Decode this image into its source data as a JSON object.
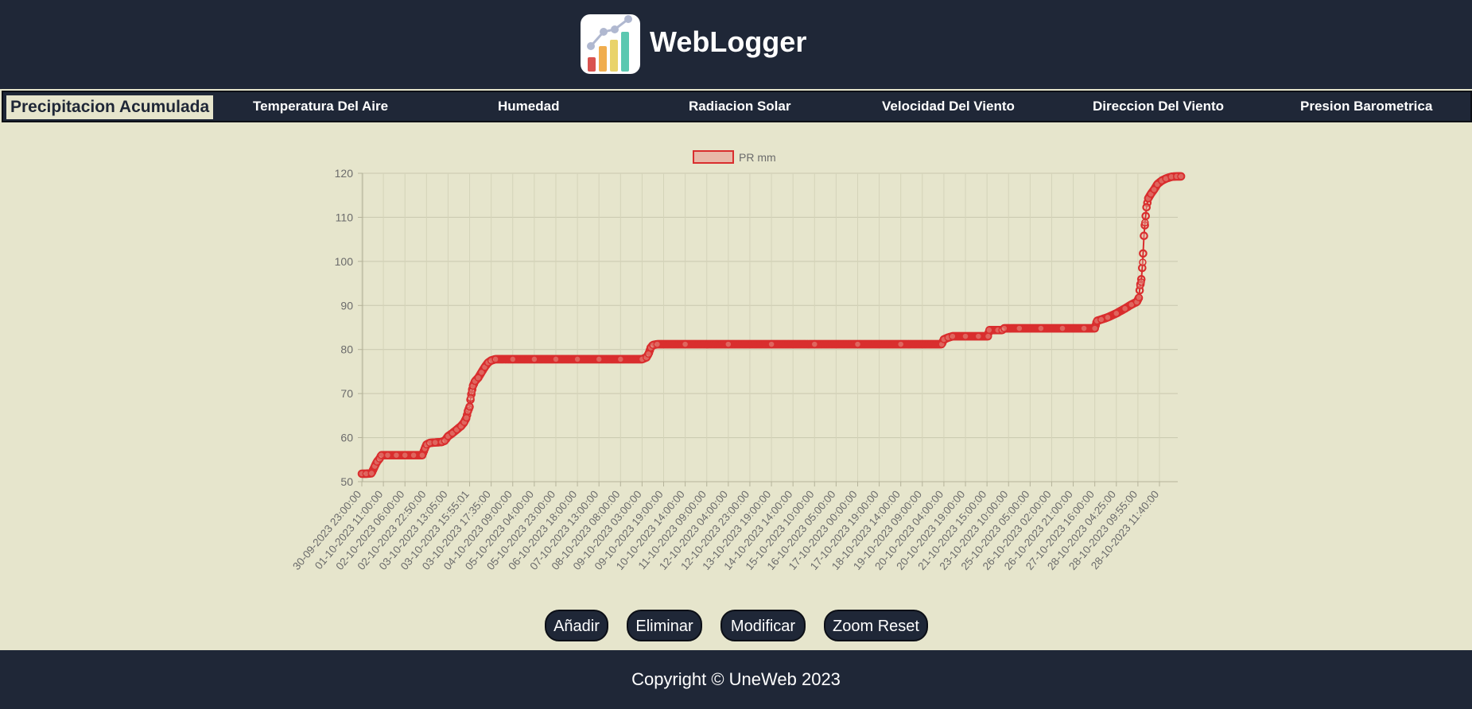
{
  "header": {
    "title": "WebLogger",
    "logo_icon": "bar-chart-logo-icon"
  },
  "nav": {
    "active_index": 0,
    "items": [
      {
        "label": "Precipitacion Acumulada"
      },
      {
        "label": "Temperatura Del Aire"
      },
      {
        "label": "Humedad"
      },
      {
        "label": "Radiacion Solar"
      },
      {
        "label": "Velocidad Del Viento"
      },
      {
        "label": "Direccion Del Viento"
      },
      {
        "label": "Presion Barometrica"
      }
    ]
  },
  "buttons": {
    "add": "Añadir",
    "delete": "Eliminar",
    "modify": "Modificar",
    "zoom_reset": "Zoom Reset"
  },
  "footer": {
    "copyright": "Copyright © UneWeb 2023"
  },
  "colors": {
    "header_bg": "#1f2737",
    "page_bg": "#e6e5cc",
    "series_line": "#d92e2e",
    "series_fill": "#e8b8a8"
  },
  "chart_data": {
    "type": "line",
    "title": "",
    "xlabel": "",
    "ylabel": "",
    "ylim": [
      50,
      120
    ],
    "yticks": [
      50,
      60,
      70,
      80,
      90,
      100,
      110,
      120
    ],
    "grid": true,
    "legend_position": "top",
    "categories": [
      "30-09-2023 23:00:00",
      "01-10-2023 11:00:00",
      "02-10-2023 06:00:00",
      "02-10-2023 22:50:00",
      "03-10-2023 13:05:00",
      "03-10-2023 15:55:01",
      "03-10-2023 17:35:00",
      "04-10-2023 09:00:00",
      "05-10-2023 04:00:00",
      "05-10-2023 23:00:00",
      "06-10-2023 18:00:00",
      "07-10-2023 13:00:00",
      "08-10-2023 08:00:00",
      "09-10-2023 03:00:00",
      "09-10-2023 19:00:00",
      "10-10-2023 14:00:00",
      "11-10-2023 09:00:00",
      "12-10-2023 04:00:00",
      "12-10-2023 23:00:00",
      "13-10-2023 19:00:00",
      "14-10-2023 14:00:00",
      "15-10-2023 10:00:00",
      "16-10-2023 05:00:00",
      "17-10-2023 00:00:00",
      "17-10-2023 19:00:00",
      "18-10-2023 14:00:00",
      "19-10-2023 09:00:00",
      "20-10-2023 04:00:00",
      "20-10-2023 19:00:00",
      "21-10-2023 15:00:00",
      "23-10-2023 10:00:00",
      "25-10-2023 05:00:00",
      "26-10-2023 02:00:00",
      "26-10-2023 21:00:00",
      "27-10-2023 16:00:00",
      "28-10-2023 04:25:00",
      "28-10-2023 09:55:00",
      "28-10-2023 11:40:00"
    ],
    "series": [
      {
        "name": "PR mm",
        "color": "#d92e2e",
        "fill": "#e8b8a8",
        "points": [
          {
            "x": 0.0,
            "y": 51.8
          },
          {
            "x": 0.2,
            "y": 51.8
          },
          {
            "x": 0.45,
            "y": 51.9
          },
          {
            "x": 0.6,
            "y": 53.5
          },
          {
            "x": 0.7,
            "y": 54.5
          },
          {
            "x": 0.82,
            "y": 55.2
          },
          {
            "x": 0.9,
            "y": 56.0
          },
          {
            "x": 1.2,
            "y": 56.0
          },
          {
            "x": 1.6,
            "y": 56.0
          },
          {
            "x": 2.0,
            "y": 56.0
          },
          {
            "x": 2.4,
            "y": 56.0
          },
          {
            "x": 2.8,
            "y": 56.0
          },
          {
            "x": 2.92,
            "y": 57.5
          },
          {
            "x": 3.0,
            "y": 58.4
          },
          {
            "x": 3.15,
            "y": 58.8
          },
          {
            "x": 3.4,
            "y": 58.9
          },
          {
            "x": 3.7,
            "y": 59.0
          },
          {
            "x": 3.85,
            "y": 59.3
          },
          {
            "x": 4.0,
            "y": 60.3
          },
          {
            "x": 4.2,
            "y": 61.0
          },
          {
            "x": 4.4,
            "y": 61.8
          },
          {
            "x": 4.6,
            "y": 62.6
          },
          {
            "x": 4.75,
            "y": 63.5
          },
          {
            "x": 4.85,
            "y": 64.5
          },
          {
            "x": 4.92,
            "y": 66.0
          },
          {
            "x": 5.0,
            "y": 67.0
          },
          {
            "x": 5.05,
            "y": 69.0
          },
          {
            "x": 5.1,
            "y": 70.4
          },
          {
            "x": 5.15,
            "y": 71.7
          },
          {
            "x": 5.25,
            "y": 72.8
          },
          {
            "x": 5.4,
            "y": 73.6
          },
          {
            "x": 5.55,
            "y": 74.8
          },
          {
            "x": 5.7,
            "y": 76.0
          },
          {
            "x": 5.85,
            "y": 77.0
          },
          {
            "x": 6.0,
            "y": 77.5
          },
          {
            "x": 6.2,
            "y": 77.8
          },
          {
            "x": 7.0,
            "y": 77.8
          },
          {
            "x": 8.0,
            "y": 77.8
          },
          {
            "x": 9.0,
            "y": 77.8
          },
          {
            "x": 10.0,
            "y": 77.8
          },
          {
            "x": 11.0,
            "y": 77.8
          },
          {
            "x": 12.0,
            "y": 77.8
          },
          {
            "x": 13.0,
            "y": 77.8
          },
          {
            "x": 13.2,
            "y": 78.2
          },
          {
            "x": 13.3,
            "y": 79.0
          },
          {
            "x": 13.4,
            "y": 80.4
          },
          {
            "x": 13.5,
            "y": 81.0
          },
          {
            "x": 13.7,
            "y": 81.2
          },
          {
            "x": 15.0,
            "y": 81.2
          },
          {
            "x": 17.0,
            "y": 81.2
          },
          {
            "x": 19.0,
            "y": 81.2
          },
          {
            "x": 21.0,
            "y": 81.2
          },
          {
            "x": 23.0,
            "y": 81.2
          },
          {
            "x": 25.0,
            "y": 81.2
          },
          {
            "x": 26.9,
            "y": 81.2
          },
          {
            "x": 27.0,
            "y": 82.3
          },
          {
            "x": 27.2,
            "y": 82.7
          },
          {
            "x": 27.4,
            "y": 83.0
          },
          {
            "x": 28.0,
            "y": 83.0
          },
          {
            "x": 28.6,
            "y": 83.0
          },
          {
            "x": 29.05,
            "y": 83.0
          },
          {
            "x": 29.1,
            "y": 84.4
          },
          {
            "x": 29.5,
            "y": 84.4
          },
          {
            "x": 29.7,
            "y": 84.4
          },
          {
            "x": 29.8,
            "y": 84.8
          },
          {
            "x": 30.5,
            "y": 84.8
          },
          {
            "x": 31.5,
            "y": 84.8
          },
          {
            "x": 32.5,
            "y": 84.8
          },
          {
            "x": 33.5,
            "y": 84.8
          },
          {
            "x": 34.0,
            "y": 84.8
          },
          {
            "x": 34.1,
            "y": 86.5
          },
          {
            "x": 34.3,
            "y": 86.8
          },
          {
            "x": 34.6,
            "y": 87.3
          },
          {
            "x": 35.0,
            "y": 88.2
          },
          {
            "x": 35.4,
            "y": 89.3
          },
          {
            "x": 35.7,
            "y": 90.2
          },
          {
            "x": 35.95,
            "y": 90.8
          },
          {
            "x": 36.05,
            "y": 91.8
          },
          {
            "x": 36.1,
            "y": 94.5
          },
          {
            "x": 36.15,
            "y": 95.3
          },
          {
            "x": 36.22,
            "y": 99.8
          },
          {
            "x": 36.28,
            "y": 105.8
          },
          {
            "x": 36.33,
            "y": 108.8
          },
          {
            "x": 36.4,
            "y": 112.3
          },
          {
            "x": 36.48,
            "y": 114.3
          },
          {
            "x": 36.6,
            "y": 115.3
          },
          {
            "x": 36.75,
            "y": 116.3
          },
          {
            "x": 36.9,
            "y": 117.5
          },
          {
            "x": 37.1,
            "y": 118.3
          },
          {
            "x": 37.3,
            "y": 118.8
          },
          {
            "x": 37.55,
            "y": 119.2
          },
          {
            "x": 37.8,
            "y": 119.3
          },
          {
            "x": 38.0,
            "y": 119.3
          }
        ]
      }
    ]
  }
}
